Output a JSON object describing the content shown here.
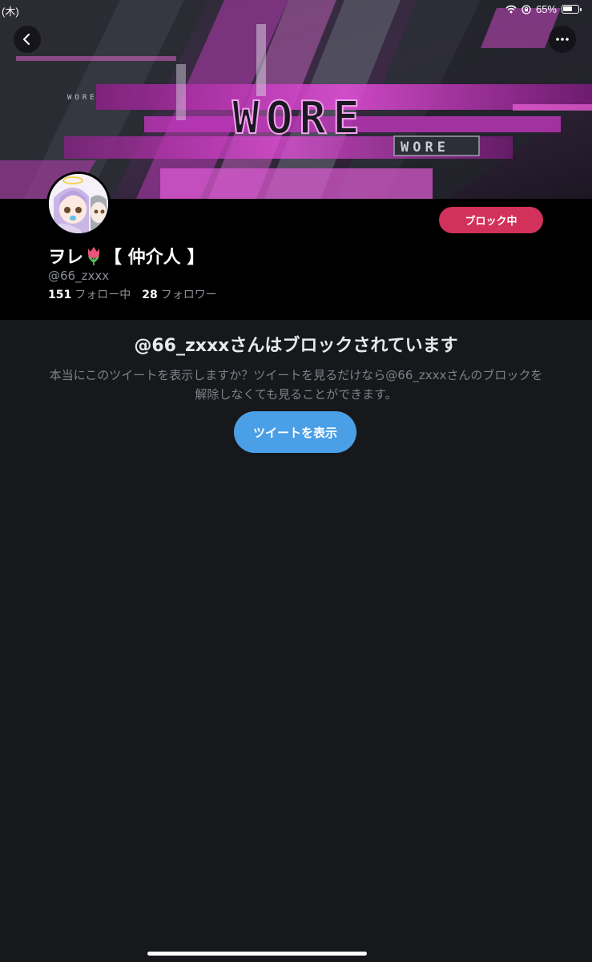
{
  "status_bar": {
    "left_text": "(木)",
    "battery_percent": "65%",
    "battery_level": 0.65
  },
  "banner": {
    "small_logo_text": "WORE",
    "big_logo_text": "WORE",
    "badge_text": "WORE",
    "colors": {
      "magenta": "#d63fd0",
      "pink": "#ff6ee8",
      "dark": "#181420"
    }
  },
  "nav": {
    "back_icon": "chevron-left-icon",
    "more_icon": "ellipsis-icon"
  },
  "profile": {
    "name_part1": "ヲレ",
    "name_emoji": "tulip-icon",
    "name_part2": "【 仲介人 】",
    "handle": "@66_zxxx",
    "following_count": "151",
    "following_label": "フォロー中",
    "followers_count": "28",
    "followers_label": "フォロワー",
    "block_button_label": "ブロック中",
    "block_button_color": "#d2325a"
  },
  "blocked_notice": {
    "title": "@66_zxxxさんはブロックされています",
    "description": "本当にこのツイートを表示しますか？ツイートを見るだけなら@66_zxxxさんのブロックを解除しなくても見ることができます。",
    "button_label": "ツイートを表示",
    "button_color": "#4a9fe6"
  }
}
